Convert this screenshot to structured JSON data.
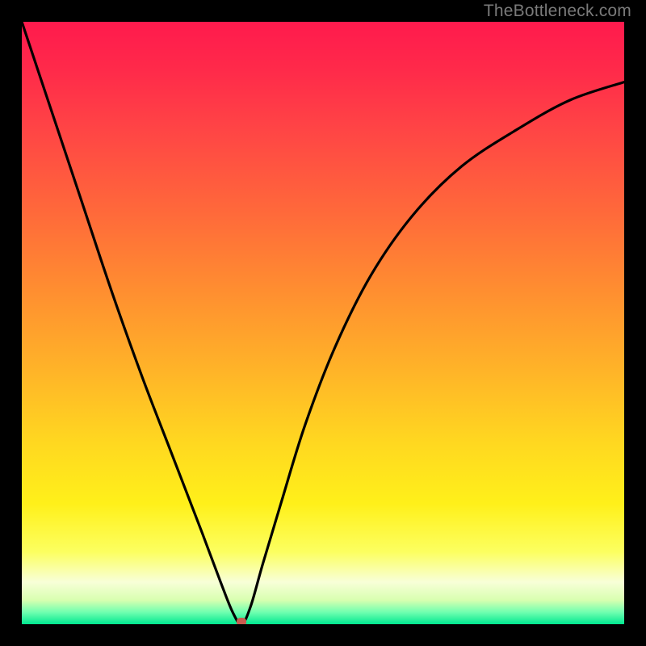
{
  "watermark": "TheBottleneck.com",
  "colors": {
    "frame": "#000000",
    "curve": "#000000",
    "dot": "#c95a4f"
  },
  "chart_data": {
    "type": "line",
    "title": "",
    "xlabel": "",
    "ylabel": "",
    "xlim": [
      0,
      100
    ],
    "ylim": [
      0,
      100
    ],
    "grid": false,
    "legend": false,
    "series": [
      {
        "name": "bottleneck-curve",
        "x": [
          0,
          5,
          10,
          15,
          20,
          25,
          30,
          33,
          35,
          36.5,
          38,
          40,
          43,
          47,
          52,
          58,
          65,
          73,
          82,
          91,
          100
        ],
        "y": [
          100,
          85,
          70,
          55,
          41,
          28,
          15,
          7,
          2,
          0,
          3,
          10,
          20,
          33,
          46,
          58,
          68,
          76,
          82,
          87,
          90
        ]
      }
    ],
    "marker": {
      "name": "minimum-dot",
      "x": 36.5,
      "y": 0
    },
    "notes": "Values are estimated from pixel positions; axes and ticks are not labeled in the source image."
  }
}
